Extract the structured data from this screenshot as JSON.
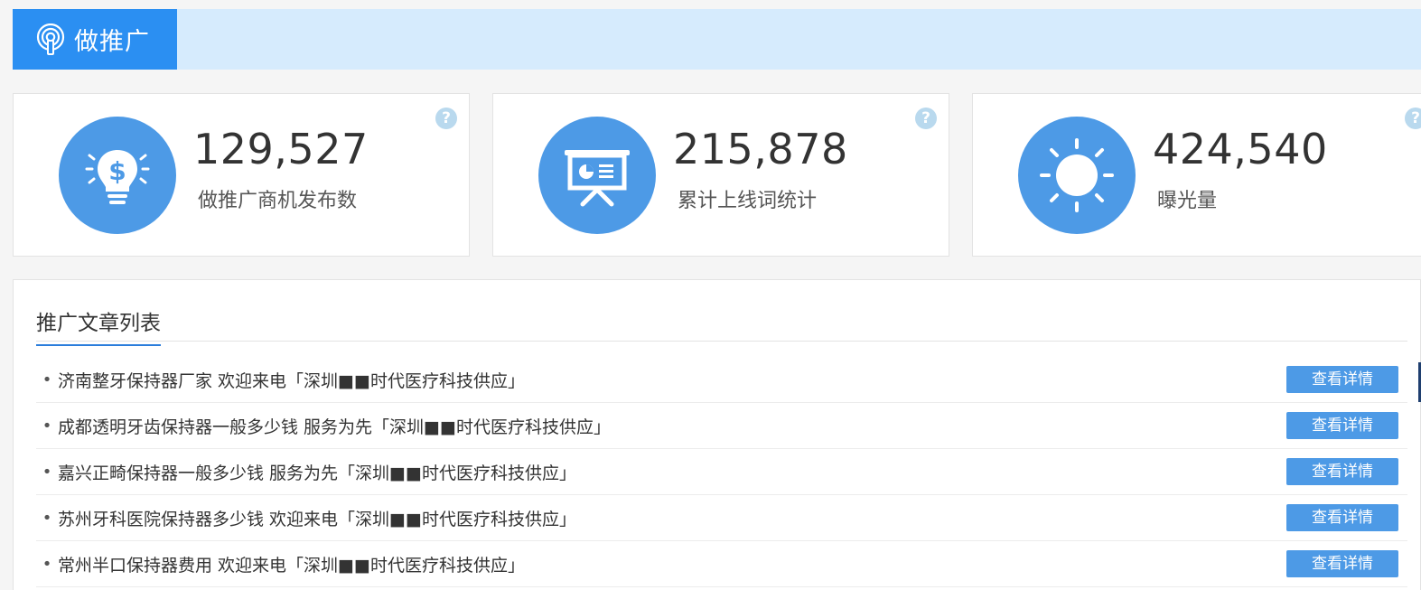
{
  "header": {
    "title": "做推广",
    "icon": "broadcast-icon"
  },
  "stats": [
    {
      "value": "129,527",
      "label": "做推广商机发布数",
      "icon": "lightbulb-dollar-icon",
      "help": "?"
    },
    {
      "value": "215,878",
      "label": "累计上线词统计",
      "icon": "presentation-board-icon",
      "help": "?"
    },
    {
      "value": "424,540",
      "label": "曝光量",
      "icon": "sun-icon",
      "help": "?"
    }
  ],
  "articles": {
    "title": "推广文章列表",
    "bullet": "•",
    "items": [
      {
        "text": "济南整牙保持器厂家 欢迎来电「深圳■■时代医疗科技供应」",
        "button": "查看详情"
      },
      {
        "text": "成都透明牙齿保持器一般多少钱 服务为先「深圳■■时代医疗科技供应」",
        "button": "查看详情"
      },
      {
        "text": "嘉兴正畸保持器一般多少钱 服务为先「深圳■■时代医疗科技供应」",
        "button": "查看详情"
      },
      {
        "text": "苏州牙科医院保持器多少钱 欢迎来电「深圳■■时代医疗科技供应」",
        "button": "查看详情"
      },
      {
        "text": "常州半口保持器费用 欢迎来电「深圳■■时代医疗科技供应」",
        "button": "查看详情"
      }
    ]
  },
  "colors": {
    "accent": "#2b8ff2",
    "header_bg": "#d6ebfd",
    "icon_circle": "#4d9ae6",
    "button": "#4d9ae6"
  }
}
